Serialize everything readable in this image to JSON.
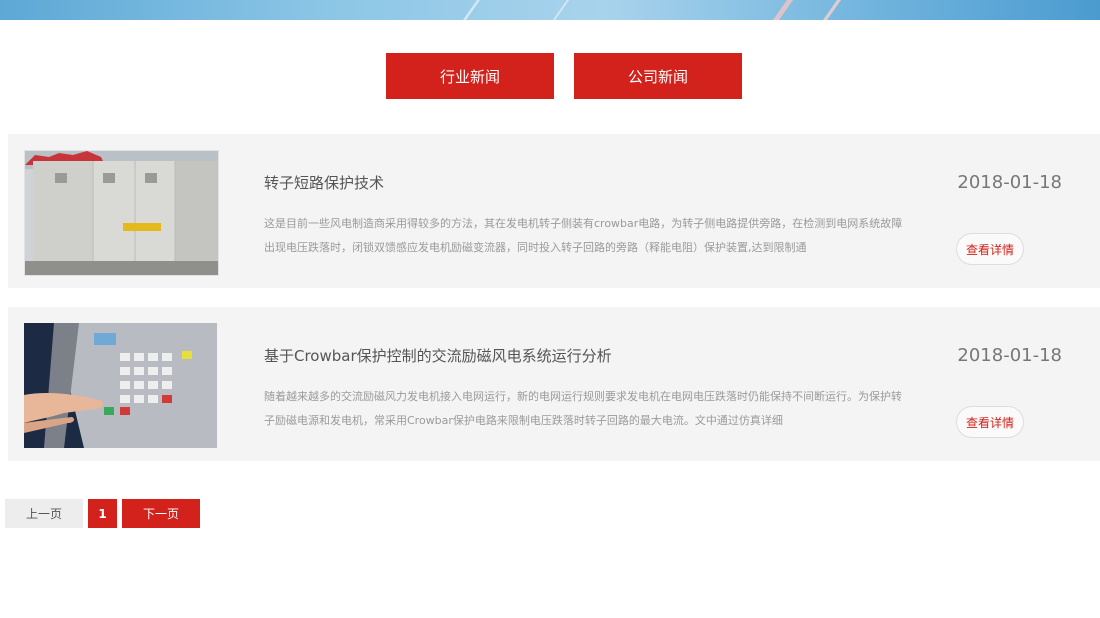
{
  "tabs": [
    {
      "label": "行业新闻"
    },
    {
      "label": "公司新闻"
    }
  ],
  "articles": [
    {
      "title": "转子短路保护技术",
      "excerpt": "这是目前一些风电制造商采用得较多的方法，其在发电机转子侧装有crowbar电路，为转子侧电路提供旁路，在检测到电网系统故障出现电压跌落时，闭锁双馈感应发电机励磁变流器，同时投入转子回路的旁路（释能电阻）保护装置,达到限制通",
      "date": "2018-01-18",
      "detail_label": "查看详情",
      "image": "container-unit-photo"
    },
    {
      "title": "基于Crowbar保护控制的交流励磁风电系统运行分析",
      "excerpt": "随着越来越多的交流励磁风力发电机接入电网运行，新的电网运行规则要求发电机在电网电压跌落时仍能保持不间断运行。为保护转子励磁电源和发电机，常采用Crowbar保护电路来限制电压跌落时转子回路的最大电流。文中通过仿真详细",
      "date": "2018-01-18",
      "detail_label": "查看详情",
      "image": "control-panel-photo"
    }
  ],
  "pagination": {
    "prev_label": "上一页",
    "current_page": "1",
    "next_label": "下一页"
  },
  "colors": {
    "accent": "#d2221b",
    "card_bg": "#f4f4f4"
  }
}
